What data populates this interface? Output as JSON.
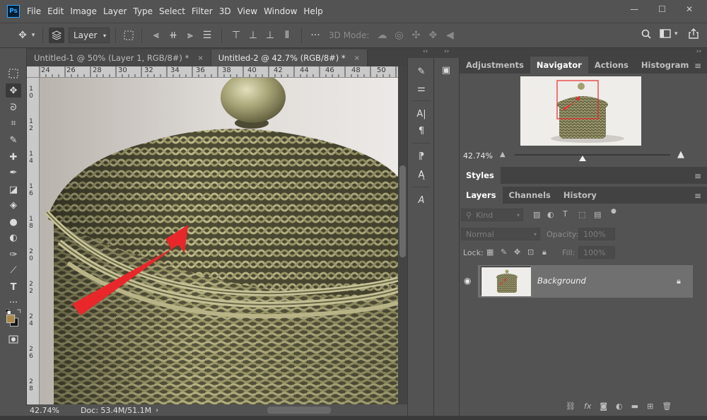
{
  "app": {
    "logo": "Ps"
  },
  "menu": [
    "File",
    "Edit",
    "Image",
    "Layer",
    "Type",
    "Select",
    "Filter",
    "3D",
    "View",
    "Window",
    "Help"
  ],
  "window_controls": {
    "minimize": "—",
    "maximize": "☐",
    "close": "✕"
  },
  "options_bar": {
    "layer_select": "Layer",
    "three_d_mode_label": "3D Mode:",
    "more": "···"
  },
  "tabs": [
    {
      "title": "Untitled-1 @ 50% (Layer 1, RGB/8#) *",
      "close": "×"
    },
    {
      "title": "Untitled-2 @ 42.7% (RGB/8#) *",
      "close": "×"
    }
  ],
  "ruler_h": [
    "24",
    "26",
    "28",
    "30",
    "32",
    "34",
    "36",
    "38",
    "40",
    "42",
    "44",
    "46",
    "48",
    "50"
  ],
  "ruler_v": [
    "1",
    "0",
    "1",
    "2",
    "1",
    "4",
    "1",
    "6",
    "1",
    "8",
    "2",
    "0",
    "2",
    "2",
    "2",
    "4",
    "2",
    "6",
    "2",
    "8"
  ],
  "status": {
    "zoom": "42.74%",
    "doc": "Doc: 53.4M/51.1M"
  },
  "panels": {
    "top_tabs": [
      "Adjustments",
      "Navigator",
      "Actions",
      "Histogram"
    ],
    "top_active": "Navigator",
    "navigator_zoom": "42.74%",
    "styles_tab": "Styles",
    "layer_tabs": [
      "Layers",
      "Channels",
      "History"
    ],
    "layers_active": "Layers",
    "kind_label": "Kind",
    "blend_mode": "Normal",
    "opacity_label": "Opacity:",
    "opacity_value": "100%",
    "lock_label": "Lock:",
    "fill_label": "Fill:",
    "fill_value": "100%",
    "layer_name": "Background",
    "menu_glyph": "≡"
  },
  "colors": {
    "accent": "#31a8ff",
    "arrow": "#e8272a",
    "basket": "#a9a577",
    "foreground_swatch": "#a68848"
  }
}
